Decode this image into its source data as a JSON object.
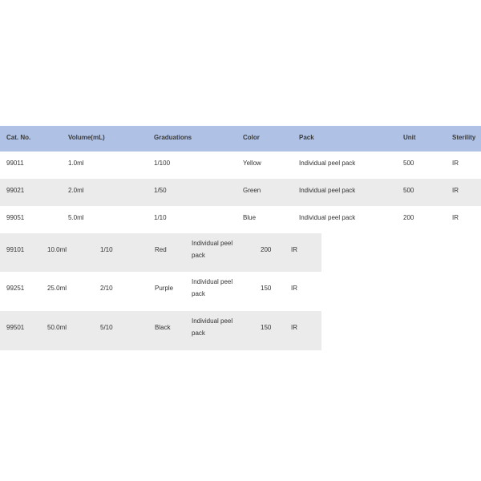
{
  "table": {
    "headers": [
      "Cat. No.",
      "Volume(mL)",
      "Graduations",
      "Color",
      "Pack",
      "Unit",
      "Sterility"
    ],
    "rows": [
      {
        "cat": "99011",
        "volume": "1.0ml",
        "graduations": "1/100",
        "color": "Yellow",
        "pack": "Individual peel pack",
        "unit": "500",
        "sterility": "IR"
      },
      {
        "cat": "99021",
        "volume": "2.0ml",
        "graduations": "1/50",
        "color": "Green",
        "pack": "Individual peel pack",
        "unit": "500",
        "sterility": "IR"
      },
      {
        "cat": "99051",
        "volume": "5.0ml",
        "graduations": "1/10",
        "color": "Blue",
        "pack": "Individual peel pack",
        "unit": "200",
        "sterility": "IR"
      },
      {
        "cat": "99101",
        "volume": "10.0ml",
        "graduations": "1/10",
        "color": "Red",
        "pack": "Individual peel pack",
        "unit": "200",
        "sterility": "IR"
      },
      {
        "cat": "99251",
        "volume": "25.0ml",
        "graduations": "2/10",
        "color": "Purple",
        "pack": "Individual peel pack",
        "unit": "150",
        "sterility": "IR"
      },
      {
        "cat": "99501",
        "volume": "50.0ml",
        "graduations": "5/10",
        "color": "Black",
        "pack": "Individual peel pack",
        "unit": "150",
        "sterility": "IR"
      }
    ]
  },
  "colors": {
    "header_bg": "#afc2e6",
    "stripe_bg": "#ebebeb",
    "text": "#333333"
  }
}
